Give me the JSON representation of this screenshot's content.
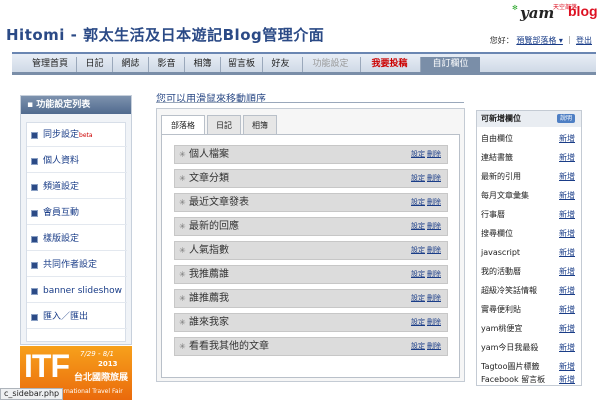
{
  "header": {
    "title": "Hitomi - 郭太生活及日本遊記Blog管理介面",
    "logo": {
      "yam": "yam",
      "small": "天空部落",
      "blog": "blog"
    },
    "greeting": "您好：",
    "view_blog": "預覽部落格 ▾",
    "logout": "登出"
  },
  "nav": {
    "tabs": [
      {
        "label": "管理首頁"
      },
      {
        "label": "日記"
      },
      {
        "label": "網誌"
      },
      {
        "label": "影音"
      },
      {
        "label": "相簿"
      },
      {
        "label": "留言板"
      },
      {
        "label": "好友"
      },
      {
        "label": "功能設定"
      },
      {
        "label": "我要投稿"
      },
      {
        "label": "自訂欄位"
      }
    ]
  },
  "sidebar": {
    "heading": "功能設定列表",
    "items": [
      {
        "label": "同步設定",
        "badge": "beta"
      },
      {
        "label": "個人資料"
      },
      {
        "label": "頻道設定"
      },
      {
        "label": "會員互動"
      },
      {
        "label": "樣版設定"
      },
      {
        "label": "共同作者設定"
      },
      {
        "label": "banner slideshow"
      },
      {
        "label": "匯入／匯出"
      }
    ]
  },
  "ad": {
    "big": "ITF",
    "dates": "7/29 - 8/1",
    "year": "2013",
    "cn": "台北國際旅展",
    "en": "International Travel Fair"
  },
  "statusbar": "c_sidebar.php",
  "main": {
    "title": "您可以用滑鼠來移動順序",
    "tabs": [
      {
        "label": "部落格"
      },
      {
        "label": "日記"
      },
      {
        "label": "相簿"
      }
    ],
    "rows": [
      {
        "label": "個人檔案"
      },
      {
        "label": "文章分類"
      },
      {
        "label": "最近文章發表"
      },
      {
        "label": "最新的回應"
      },
      {
        "label": "人氣指數"
      },
      {
        "label": "我推薦誰"
      },
      {
        "label": "誰推薦我"
      },
      {
        "label": "誰來我家"
      },
      {
        "label": "看看我其他的文章"
      }
    ],
    "set_label": "設定",
    "delete_label": "刪除"
  },
  "right": {
    "heading": "可新增欄位",
    "help": "說明",
    "add_label": "新增",
    "items": [
      {
        "label": "自由欄位"
      },
      {
        "label": "連結書籤"
      },
      {
        "label": "最新的引用"
      },
      {
        "label": "每月文章彙集"
      },
      {
        "label": "行事曆"
      },
      {
        "label": "搜尋欄位"
      },
      {
        "label": "javascript"
      },
      {
        "label": "我的活動曆"
      },
      {
        "label": "超級冷笑話情報"
      },
      {
        "label": "實尋便利貼"
      },
      {
        "label": "yam桃便宜"
      },
      {
        "label": "yam今日我最殺"
      },
      {
        "label": "Tagtoo圖片標籤"
      },
      {
        "label": "Facebook 留言板"
      }
    ]
  }
}
